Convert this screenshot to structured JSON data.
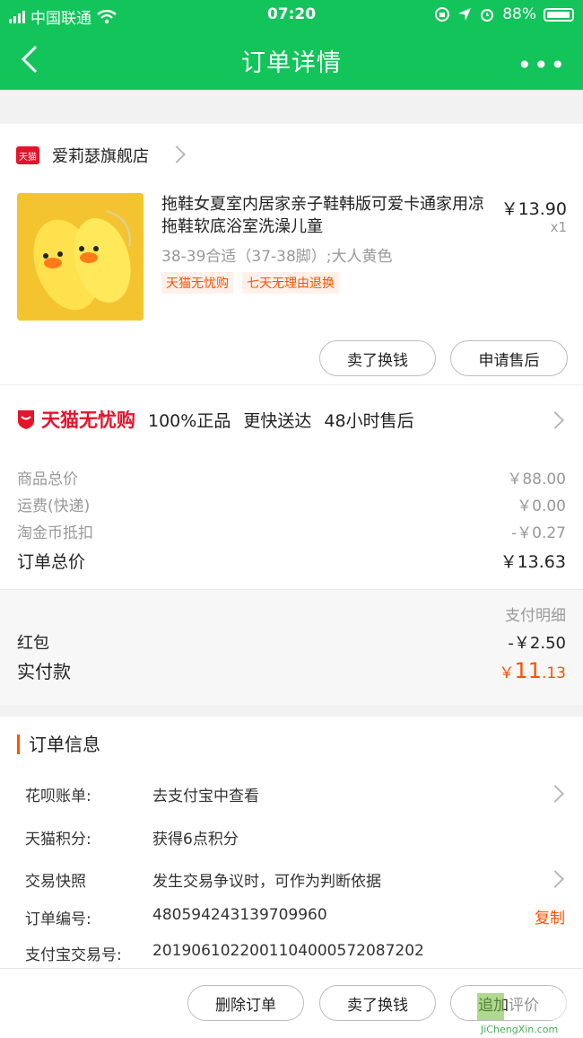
{
  "status_bar": {
    "carrier": "中国联通",
    "time": "07:20",
    "battery": "88%"
  },
  "nav": {
    "title": "订单详情"
  },
  "shop": {
    "logo_text": "天猫",
    "name": "爱莉瑟旗舰店"
  },
  "product": {
    "name": "拖鞋女夏室内居家亲子鞋韩版可爱卡通家用凉拖鞋软底浴室洗澡儿童",
    "spec": "38-39合适（37-38脚）;大人黄色",
    "tags": [
      "天猫无忧购",
      "七天无理由退换"
    ],
    "price": "￥13.90",
    "quantity": "x1"
  },
  "item_actions": {
    "sell": "卖了换钱",
    "after_sales": "申请售后"
  },
  "promise": {
    "logo": "天猫无忧购",
    "text": "100%正品 更快送达 48小时售后"
  },
  "price_summary": {
    "goods_label": "商品总价",
    "goods_value": "￥88.00",
    "shipping_label": "运费(快递)",
    "shipping_value": "￥0.00",
    "coin_label": "淘金币抵扣",
    "coin_value": "-￥0.27",
    "total_label": "订单总价",
    "total_value": "￥13.63"
  },
  "payment": {
    "detail_label": "支付明细",
    "redpacket_label": "红包",
    "redpacket_value": "-￥2.50",
    "paid_label": "实付款",
    "paid_currency": "￥",
    "paid_int": "11",
    "paid_dec": ".13"
  },
  "order_info": {
    "title": "订单信息",
    "rows": [
      {
        "key": "花呗账单:",
        "value": "去支付宝中查看"
      },
      {
        "key": "天猫积分:",
        "value": "获得6点积分"
      },
      {
        "key": "交易快照",
        "value": "发生交易争议时，可作为判断依据"
      },
      {
        "key": "订单编号:",
        "value": "480594243139709960"
      },
      {
        "key": "支付宝交易号:",
        "value": "2019061022001104000572087202"
      }
    ],
    "copy_label": "复制"
  },
  "footer": {
    "delete": "删除订单",
    "sell": "卖了换钱",
    "review": "追加评价"
  },
  "watermark": {
    "text": "JiChengXin.com"
  },
  "colors": {
    "brand_green": "#13c45b",
    "accent_orange": "#ff5000",
    "tmall_red": "#e5142a"
  }
}
